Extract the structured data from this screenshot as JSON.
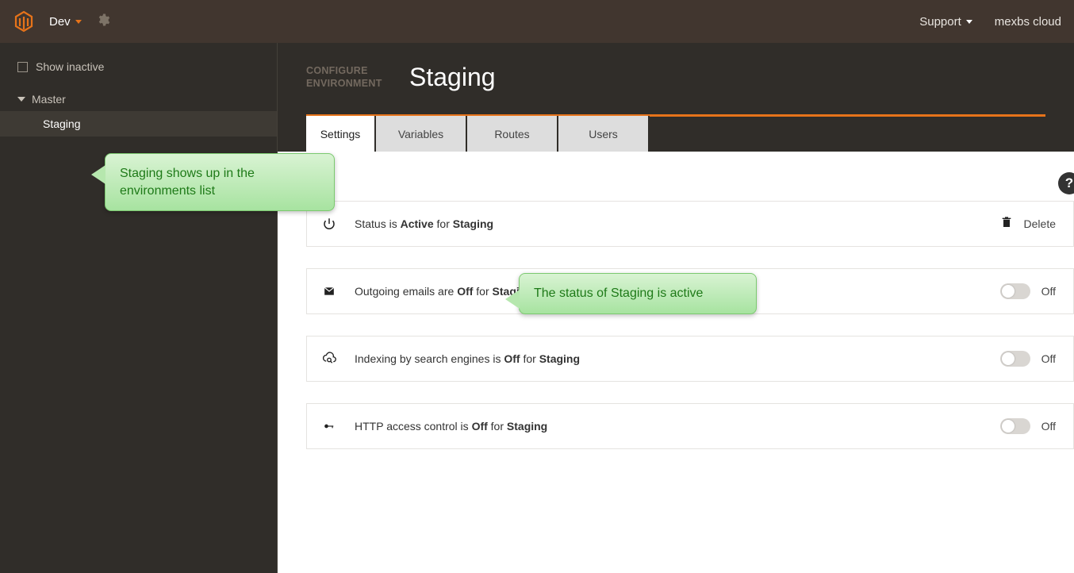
{
  "topbar": {
    "env_label": "Dev",
    "support_label": "Support",
    "account_label": "mexbs cloud"
  },
  "sidebar": {
    "show_inactive_label": "Show inactive",
    "root": "Master",
    "child": "Staging"
  },
  "header": {
    "breadcrumb_line1": "CONFIGURE",
    "breadcrumb_line2": "ENVIRONMENT",
    "title": "Staging"
  },
  "tabs": {
    "t0": "Settings",
    "t1": "Variables",
    "t2": "Routes",
    "t3": "Users"
  },
  "rows": {
    "status": {
      "pre": "Status is ",
      "state": "Active",
      "mid": " for ",
      "env": "Staging",
      "delete": "Delete"
    },
    "emails": {
      "pre": "Outgoing emails are ",
      "state": "Off",
      "mid": " for ",
      "env": "Staging",
      "off": "Off"
    },
    "indexing": {
      "pre": "Indexing by search engines is ",
      "state": "Off",
      "mid": " for ",
      "env": "Staging",
      "off": "Off"
    },
    "http": {
      "pre": "HTTP access control is ",
      "state": "Off",
      "mid": " for ",
      "env": "Staging",
      "off": "Off"
    }
  },
  "callouts": {
    "c1": "Staging shows up in the environments list",
    "c2": "The status of Staging is active"
  }
}
